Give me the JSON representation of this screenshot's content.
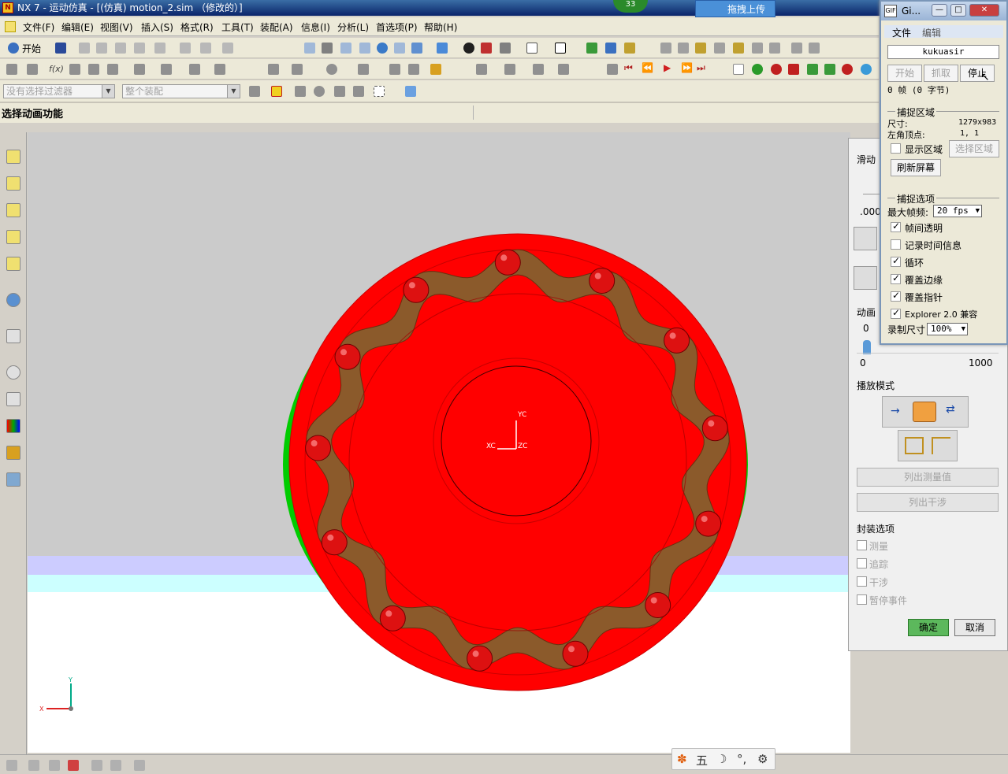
{
  "window": {
    "title": "NX 7 - 运动仿真 - [(仿真) motion_2.sim （修改的）]",
    "badge": "33",
    "upload_label": "拖拽上传"
  },
  "menu": [
    "文件(F)",
    "编辑(E)",
    "视图(V)",
    "插入(S)",
    "格式(R)",
    "工具(T)",
    "装配(A)",
    "信息(I)",
    "分析(L)",
    "首选项(P)",
    "帮助(H)"
  ],
  "toolbar": {
    "start_label": "开始",
    "filter_placeholder": "没有选择过滤器",
    "assembly_placeholder": "整个装配"
  },
  "cue": {
    "text": "选择动画功能"
  },
  "viewport": {
    "wcs_labels": {
      "yc": "YC",
      "xc": "XC",
      "zc": "ZC"
    },
    "triad": {
      "x": "X",
      "y": "Y"
    },
    "colors": {
      "disc": "#ff0000",
      "rim": "#00cc00",
      "chain": "#8b5a2b",
      "balls": "#dd1111",
      "background": "#cbcbcb"
    }
  },
  "ime": [
    "五",
    "☽",
    "⚙"
  ],
  "anim_panel": {
    "slider_label": "滑动",
    "slider_value": ".000",
    "speed_label": "动画",
    "speed_zero": "0",
    "scale_min": "0",
    "scale_max": "1000",
    "playback_mode_label": "播放模式",
    "list_measures": "列出测量值",
    "list_interference": "列出干涉",
    "pack_options_label": "封装选项",
    "pack_options": [
      "测量",
      "追踪",
      "干涉",
      "暂停事件"
    ],
    "ok": "确定",
    "cancel": "取消"
  },
  "gif_recorder": {
    "title": "Gi...",
    "menu": [
      "文件",
      "编辑"
    ],
    "user": "kukuasir",
    "buttons": {
      "start": "开始",
      "capture": "抓取",
      "stop": "停止"
    },
    "frames": "0 帧 (0 字节)",
    "capture_area_label": "捕捉区域",
    "size_label": "尺寸:",
    "size_value": "1279x983",
    "corner_label": "左角顶点:",
    "corner_value": "1, 1",
    "show_area": "显示区域",
    "select_area": "选择区域",
    "refresh": "刷新屏幕",
    "capture_options_label": "捕捉选项",
    "max_fps_label": "最大帧频:",
    "max_fps_value": "20 fps",
    "options": [
      {
        "label": "帧间透明",
        "checked": true
      },
      {
        "label": "记录时间信息",
        "checked": false
      },
      {
        "label": "循环",
        "checked": true
      },
      {
        "label": "覆盖边缘",
        "checked": true
      },
      {
        "label": "覆盖指针",
        "checked": true
      },
      {
        "label": "Explorer 2.0 兼容",
        "checked": true
      }
    ],
    "record_size_label": "录制尺寸",
    "record_size_value": "100%"
  }
}
